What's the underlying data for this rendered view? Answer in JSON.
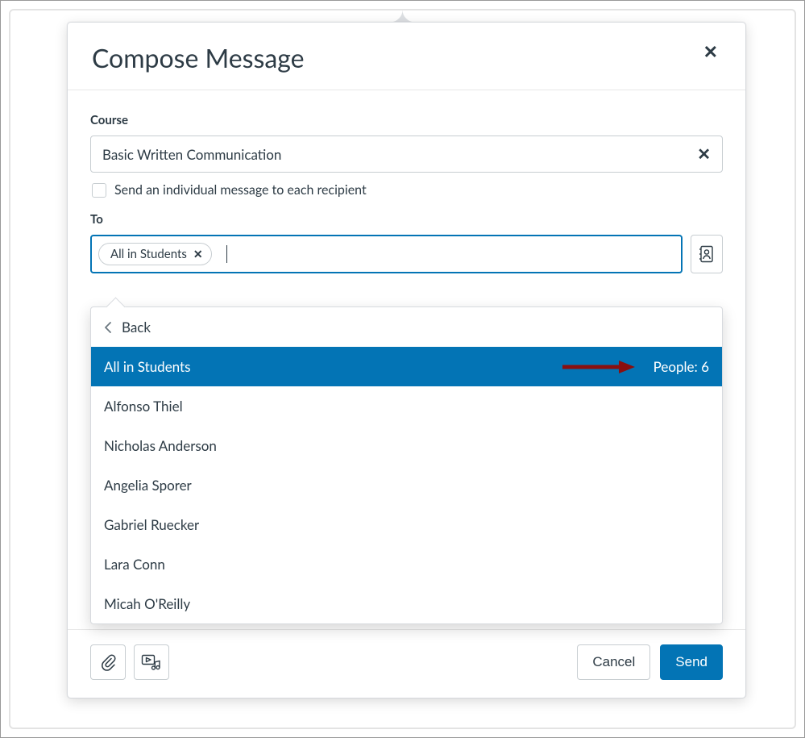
{
  "modal": {
    "title": "Compose Message",
    "course_label": "Course",
    "course_value": "Basic Written Communication",
    "individual_checkbox_label": "Send an individual message to each recipient",
    "to_label": "To",
    "chip_label": "All in Students",
    "dropdown": {
      "back_label": "Back",
      "selected": {
        "label": "All in Students",
        "people_label": "People: 6"
      },
      "items": [
        "Alfonso Thiel",
        "Nicholas Anderson",
        "Angelia Sporer",
        "Gabriel Ruecker",
        "Lara Conn",
        "Micah O'Reilly"
      ]
    },
    "footer": {
      "cancel": "Cancel",
      "send": "Send"
    }
  }
}
